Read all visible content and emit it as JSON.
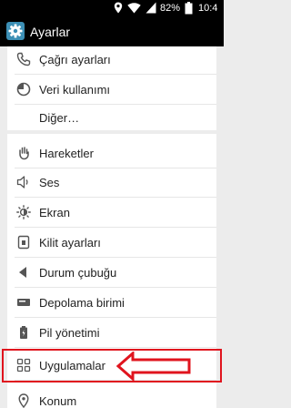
{
  "status_bar": {
    "battery_percent": "82%",
    "clock": "10:4",
    "icons": [
      "location-icon",
      "wifi-icon",
      "signal-icon",
      "battery-icon"
    ]
  },
  "action_bar": {
    "title": "Ayarlar",
    "icon": "settings-app-icon"
  },
  "sections": [
    {
      "items": [
        {
          "label": "Çağrı ayarları",
          "icon": "phone-icon"
        },
        {
          "label": "Veri kullanımı",
          "icon": "data-usage-icon"
        },
        {
          "label": "Diğer…",
          "icon": ""
        }
      ]
    },
    {
      "items": [
        {
          "label": "Hareketler",
          "icon": "hand-icon"
        },
        {
          "label": "Ses",
          "icon": "speaker-icon"
        },
        {
          "label": "Ekran",
          "icon": "brightness-icon"
        },
        {
          "label": "Kilit ayarları",
          "icon": "lock-icon"
        },
        {
          "label": "Durum çubuğu",
          "icon": "status-bar-icon"
        },
        {
          "label": "Depolama birimi",
          "icon": "storage-icon"
        },
        {
          "label": "Pil yönetimi",
          "icon": "battery-icon"
        },
        {
          "label": "Uygulamalar",
          "icon": "apps-icon"
        },
        {
          "label": "Konum",
          "icon": "location-icon"
        }
      ]
    }
  ],
  "annotation": {
    "highlight_color": "#e0141e",
    "target": "Uygulamalar"
  }
}
